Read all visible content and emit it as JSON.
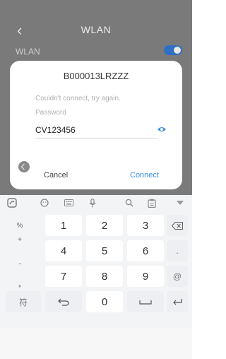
{
  "app": {
    "title": "WLAN",
    "wlan_label": "WLAN"
  },
  "dialog": {
    "network": "B000013LRZZZ",
    "error": "Couldn't connect, try again.",
    "password_label": "Password",
    "password_value": "CV123456",
    "cancel": "Cancel",
    "connect": "Connect",
    "accent": "#3a8ee6"
  },
  "keyboard": {
    "side_symbols": [
      "%",
      "+",
      "-",
      "*"
    ],
    "row1": [
      "1",
      "2",
      "3"
    ],
    "row2": [
      "4",
      "5",
      "6"
    ],
    "row3": [
      "7",
      "8",
      "9"
    ],
    "row4_left": "符",
    "row4_zero": "0",
    "row2_right": ".",
    "row3_right": "@"
  }
}
